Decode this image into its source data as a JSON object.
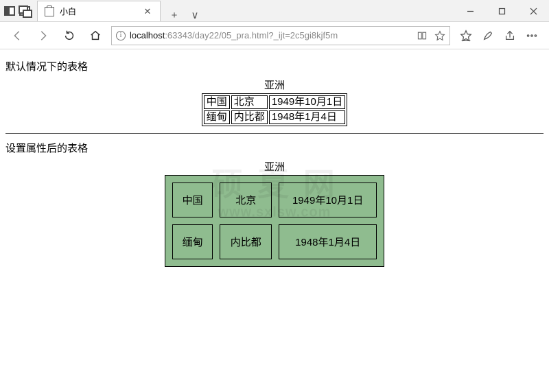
{
  "window": {
    "tab_title": "小白",
    "new_tab_glyph": "+",
    "dropdown_glyph": "∨"
  },
  "address": {
    "host": "localhost",
    "rest": ":63343/day22/05_pra.html?_ijt=2c5gi8kjf5m"
  },
  "page": {
    "section1_label": "默认情况下的表格",
    "section2_label": "设置属性后的表格",
    "caption": "亚洲",
    "table": {
      "rows": [
        {
          "c1": "中国",
          "c2": "北京",
          "c3": "1949年10月1日"
        },
        {
          "c1": "缅甸",
          "c2": "内比都",
          "c3": "1948年1月4日"
        }
      ]
    }
  },
  "watermark": {
    "line1": "硕 夏 网",
    "line2": "www.sxlsw.com"
  }
}
